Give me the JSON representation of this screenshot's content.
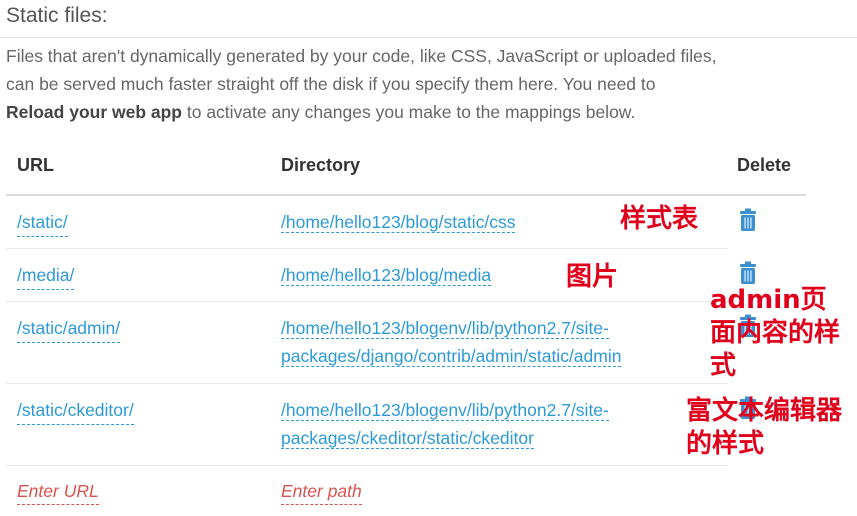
{
  "section": {
    "title": "Static files:",
    "desc_line1": "Files that aren't dynamically generated by your code, like CSS, JavaScript or uploaded files,",
    "desc_line2": "can be served much faster straight off the disk if you specify them here. You need to",
    "desc_bold": "Reload your web app",
    "desc_line3_rest": " to activate any changes you make to the mappings below."
  },
  "table": {
    "headers": {
      "url": "URL",
      "directory": "Directory",
      "delete": "Delete"
    },
    "rows": [
      {
        "url": "/static/",
        "dir": "/home/hello123/blog/static/css"
      },
      {
        "url": "/media/",
        "dir": "/home/hello123/blog/media"
      },
      {
        "url": "/static/admin/",
        "dir": "/home/hello123/blogenv/lib/python2.7/site-packages/django/contrib/admin/static/admin"
      },
      {
        "url": "/static/ckeditor/",
        "dir": "/home/hello123/blogenv/lib/python2.7/site-packages/ckeditor/static/ckeditor"
      }
    ],
    "new_row": {
      "url_placeholder": "Enter URL",
      "path_placeholder": "Enter path"
    }
  },
  "annotations": {
    "a1": "样式表",
    "a2": "图片",
    "a3": "admin页面内容的样式",
    "a4": "富文本编辑器的样式"
  },
  "colors": {
    "link": "#2d9ad6",
    "annotation": "#e0001b",
    "placeholder": "#d9534f"
  }
}
